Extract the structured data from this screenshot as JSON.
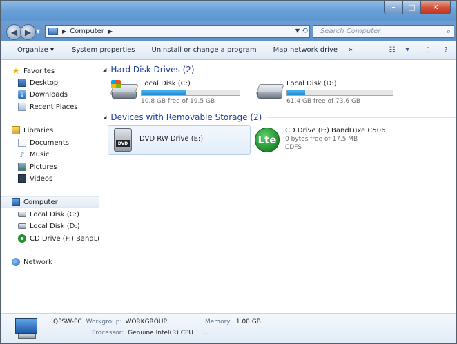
{
  "window": {
    "controls": {
      "minimize": "–",
      "maximize": "□",
      "close": "✕"
    }
  },
  "nav": {
    "back_icon": "back-arrow-icon",
    "forward_icon": "forward-arrow-icon",
    "address_path": [
      "Computer"
    ],
    "search_placeholder": "Search Computer"
  },
  "toolbar": {
    "organize": "Organize ▾",
    "system_properties": "System properties",
    "uninstall": "Uninstall or change a program",
    "map_drive": "Map network drive",
    "more": "»"
  },
  "sidebar": {
    "favorites": {
      "label": "Favorites",
      "items": [
        "Desktop",
        "Downloads",
        "Recent Places"
      ]
    },
    "libraries": {
      "label": "Libraries",
      "items": [
        "Documents",
        "Music",
        "Pictures",
        "Videos"
      ]
    },
    "computer": {
      "label": "Computer",
      "items": [
        "Local Disk (C:)",
        "Local Disk (D:)",
        "CD Drive (F:) BandLu"
      ]
    },
    "network": {
      "label": "Network"
    }
  },
  "main": {
    "hard_disk_header": "Hard Disk Drives (2)",
    "removable_header": "Devices with Removable Storage (2)",
    "drives": [
      {
        "name": "Local Disk (C:)",
        "free": "10.8 GB free of 19.5 GB",
        "used_fraction": 0.45
      },
      {
        "name": "Local Disk (D:)",
        "free": "61.4 GB free of 73.6 GB",
        "used_fraction": 0.17
      }
    ],
    "dvd": {
      "name": "DVD RW Drive (E:)",
      "label": "DVD"
    },
    "cd": {
      "name": "CD Drive (F:) BandLuxe C506",
      "free": "0 bytes free of 17.5 MB",
      "fs": "CDFS",
      "logo": "Lte"
    }
  },
  "details": {
    "pc_name": "QPSW-PC",
    "workgroup_key": "Workgroup:",
    "workgroup_val": "WORKGROUP",
    "memory_key": "Memory:",
    "memory_val": "1.00 GB",
    "processor_key": "Processor:",
    "processor_val": "Genuine Intel(R) CPU",
    "processor_more": "..."
  },
  "colors": {
    "accent_blue": "#1e3f9c",
    "bar_fill": "#1f8ad2",
    "cd_green": "#1c8b2b"
  }
}
